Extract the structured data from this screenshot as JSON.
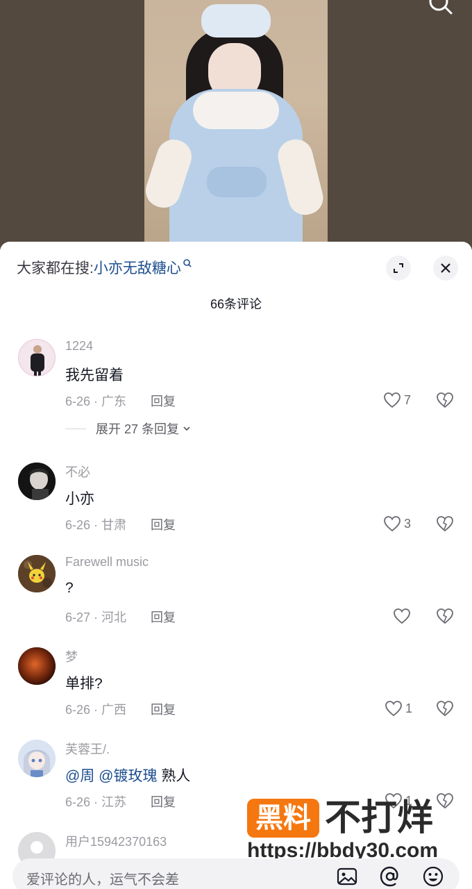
{
  "search_bar": {
    "prefix": "大家都在搜:",
    "keyword": "小亦无敌糖心"
  },
  "header": {
    "comment_count": "66条评论"
  },
  "comments": [
    {
      "user": "1224",
      "text": "我先留着",
      "date_location": "6-26 · 广东",
      "reply_label": "回复",
      "likes": "7",
      "expand_label": "展开 27 条回复"
    },
    {
      "user": "不必",
      "text": "小亦",
      "date_location": "6-26 · 甘肃",
      "reply_label": "回复",
      "likes": "3"
    },
    {
      "user": "Farewell music",
      "text": "?",
      "date_location": "6-27 · 河北",
      "reply_label": "回复",
      "likes": ""
    },
    {
      "user": "梦",
      "text": "单排?",
      "date_location": "6-26 · 广西",
      "reply_label": "回复",
      "likes": "1"
    },
    {
      "user": "芙蓉王/.",
      "mention_1": "@周",
      "mention_2": "@镀玫瑰",
      "text_tail": "熟人",
      "date_location": "6-26 · 江苏",
      "reply_label": "回复",
      "likes": "1"
    },
    {
      "user": "用户15942370163"
    }
  ],
  "watermark": {
    "badge": "黑料",
    "word": "不打烊",
    "url": "https://bbdy30.com"
  },
  "input": {
    "placeholder": "爱评论的人，运气不会差"
  },
  "colors": {
    "keyword_link": "#1d4e8f",
    "watermark_orange": "#f5770f"
  }
}
